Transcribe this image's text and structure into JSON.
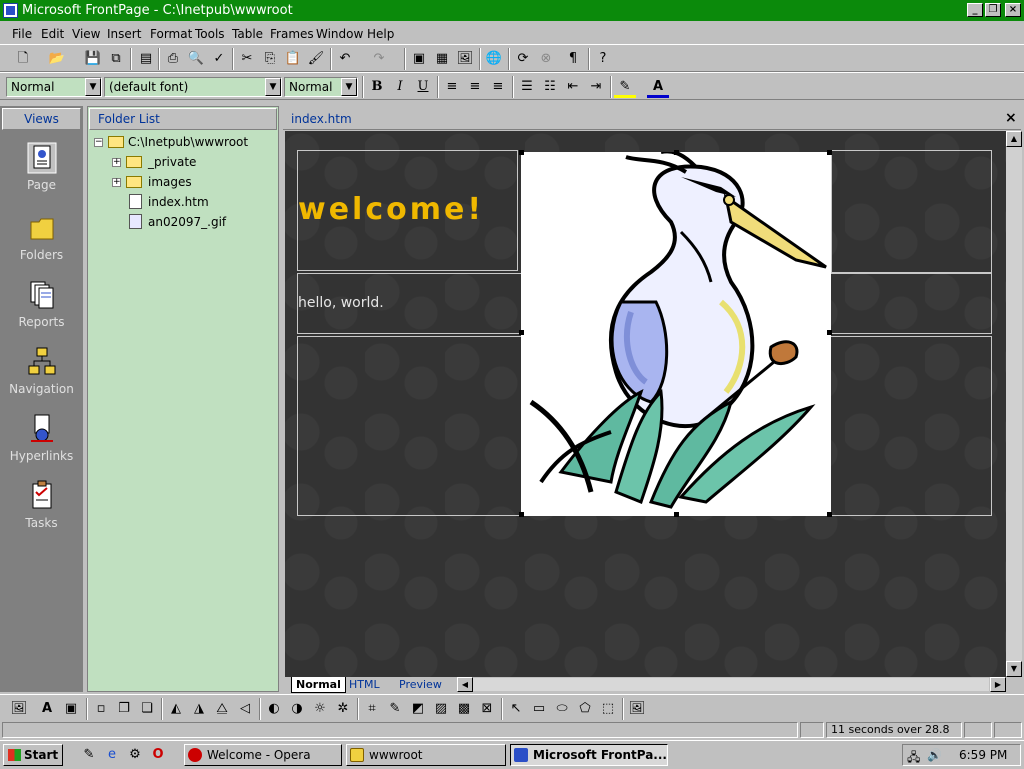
{
  "window": {
    "title": "Microsoft FrontPage - C:\\Inetpub\\wwwroot",
    "minimize": "_",
    "restore": "❐",
    "close": "×"
  },
  "menu": [
    "File",
    "Edit",
    "View",
    "Insert",
    "Format",
    "Tools",
    "Table",
    "Frames",
    "Window",
    "Help"
  ],
  "format_bar": {
    "style": "Normal",
    "font": "(default font)",
    "size": "Normal",
    "bold": "B",
    "italic": "I",
    "underline": "U"
  },
  "views": {
    "header": "Views",
    "items": [
      "Page",
      "Folders",
      "Reports",
      "Navigation",
      "Hyperlinks",
      "Tasks"
    ]
  },
  "folder_list": {
    "header": "Folder List",
    "root": "C:\\Inetpub\\wwwroot",
    "items": [
      "_private",
      "images",
      "index.htm",
      "an02097_.gif"
    ]
  },
  "editor": {
    "tab": "index.htm",
    "close": "×",
    "welcome": "welcome!",
    "hello": "hello, world.",
    "bottom_tabs": [
      "Normal",
      "HTML",
      "Preview"
    ]
  },
  "status": {
    "download_time": "11 seconds over 28.8"
  },
  "taskbar": {
    "start": "Start",
    "buttons": [
      "Welcome - Opera",
      "wwwroot",
      "Microsoft FrontPa..."
    ],
    "clock": "6:59 PM"
  },
  "colors": {
    "titlebar": "#0b8a0b",
    "panel_green": "#c0e0c0",
    "canvas": "#333333",
    "welcome": "#f0b800"
  }
}
